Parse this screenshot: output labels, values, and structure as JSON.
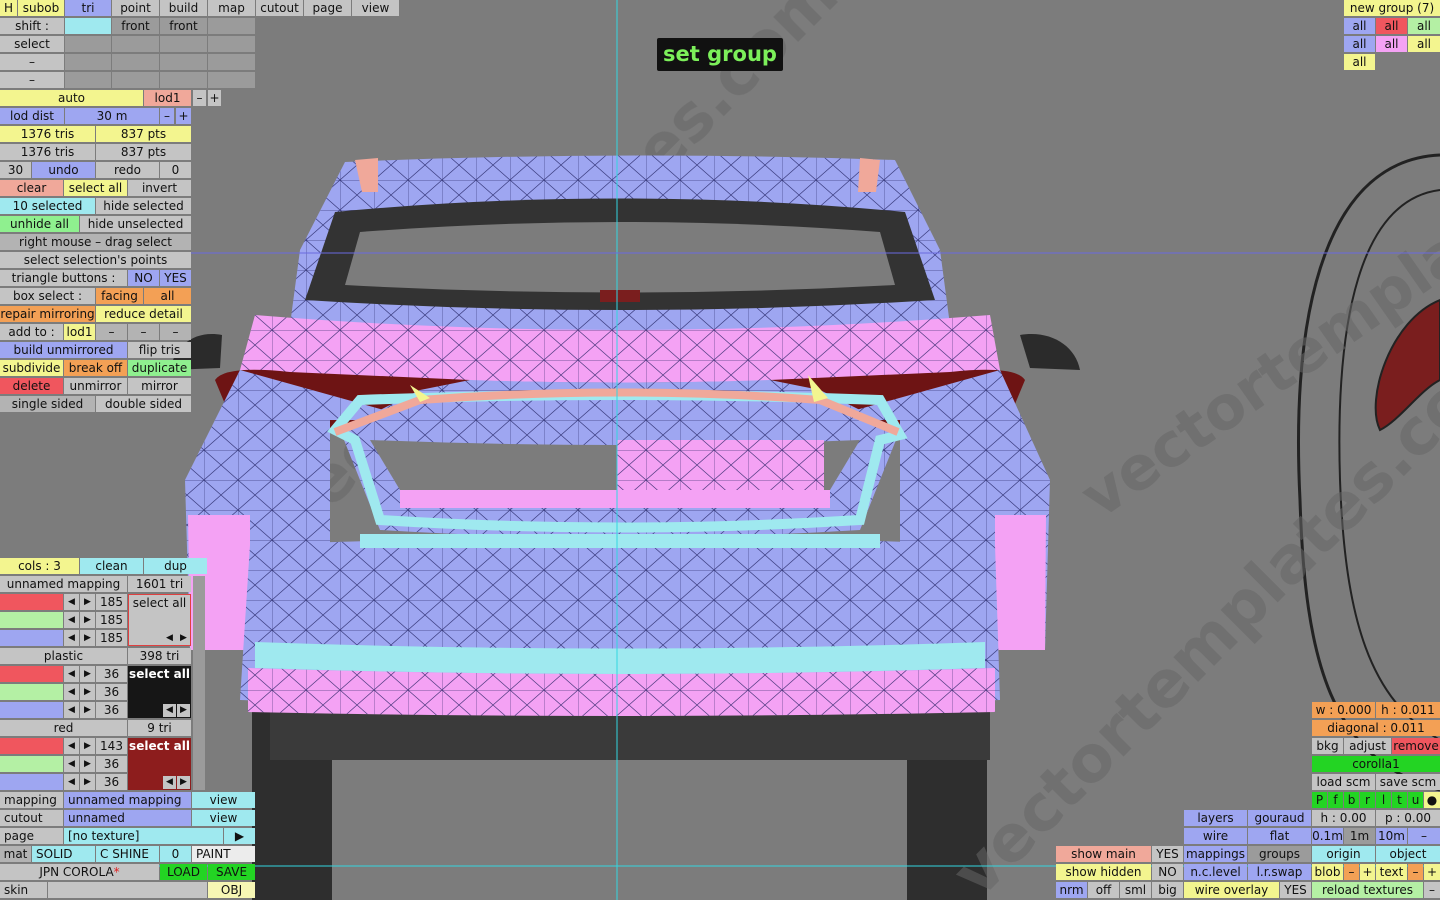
{
  "title_badge": "set group",
  "top_menu": {
    "h": "H",
    "subob": "subob",
    "tri": "tri",
    "point": "point",
    "build": "build",
    "map": "map",
    "cutout": "cutout",
    "page": "page",
    "view": "view",
    "shift": "shift :",
    "front1": "front",
    "front2": "front",
    "select": "select",
    "dash1": "–",
    "dash2": "–"
  },
  "lod": {
    "auto": "auto",
    "lod1": "lod1",
    "minus": "–",
    "plus": "+",
    "lod_dist": "lod dist",
    "dist_value": "30 m",
    "dist_minus": "–",
    "dist_plus": "+",
    "tris1": "1376 tris",
    "pts1": "837 pts",
    "tris2": "1376 tris",
    "pts2": "837 pts"
  },
  "edit": {
    "undo_count": "30",
    "undo": "undo",
    "redo": "redo",
    "redo_count": "0",
    "clear": "clear",
    "select_all": "select all",
    "invert": "invert",
    "selected_count": "10 selected",
    "hide_selected": "hide selected",
    "unhide_all": "unhide all",
    "hide_unselected": "hide unselected",
    "right_mouse": "right mouse – drag select",
    "select_points": "select selection's points",
    "triangle_buttons": "triangle buttons :",
    "no": "NO",
    "yes": "YES",
    "box_select": "box select :",
    "facing": "facing",
    "all": "all",
    "repair_mirroring": "repair mirroring",
    "reduce_detail": "reduce detail",
    "add_to": "add to :",
    "add_lod1": "lod1",
    "add_d1": "–",
    "add_d2": "–",
    "add_d3": "–",
    "build_unmirrored": "build unmirrored",
    "flip_tris": "flip tris",
    "subdivide": "subdivide",
    "break_off": "break off",
    "duplicate": "duplicate",
    "delete": "delete",
    "unmirror": "unmirror",
    "mirror": "mirror",
    "single_sided": "single sided",
    "double_sided": "double sided"
  },
  "materials": {
    "cols": "cols : 3",
    "clean": "clean",
    "dup": "dup",
    "groups": [
      {
        "name": "unnamed mapping",
        "tri": "1601 tri",
        "r": "185",
        "g": "185",
        "b": "185",
        "select_all": "select all"
      },
      {
        "name": "plastic",
        "tri": "398 tri",
        "r": "36",
        "g": "36",
        "b": "36",
        "select_all": "select all"
      },
      {
        "name": "red",
        "tri": "9 tri",
        "r": "143",
        "g": "36",
        "b": "36",
        "select_all": "select all"
      }
    ]
  },
  "bottom_left": {
    "mapping_label": "mapping",
    "mapping_value": "unnamed mapping",
    "view1": "view",
    "cutout_label": "cutout",
    "cutout_value": "unnamed",
    "view2": "view",
    "page_label": "page",
    "page_value": "[no texture]",
    "arrow": "▶",
    "mat": "mat",
    "solid": "SOLID",
    "cshine": "C SHINE",
    "zero": "0",
    "paint": "PAINT",
    "file_name": "JPN COROLA",
    "asterisk": "*",
    "load": "LOAD",
    "save": "SAVE",
    "skin": "skin",
    "obj": "OBJ"
  },
  "top_right": {
    "new_group": "new group (7)",
    "all": [
      "all",
      "all",
      "all",
      "all",
      "all",
      "all",
      "all"
    ]
  },
  "right_panel": {
    "w": "w : 0.000",
    "h": "h : 0.011",
    "diagonal": "diagonal : 0.011",
    "bkg": "bkg",
    "adjust": "adjust",
    "remove": "remove",
    "corolla": "corolla1",
    "load_scm": "load scm",
    "save_scm": "save scm",
    "letters": [
      "P",
      "f",
      "b",
      "r",
      "l",
      "t",
      "u",
      "●"
    ],
    "layers": "layers",
    "gouraud": "gouraud",
    "h0": "h : 0.00",
    "p0": "p : 0.00",
    "wire": "wire",
    "flat": "flat",
    "m01": "0.1m",
    "m1": "1m",
    "m10": "10m",
    "mdash": "–",
    "show_main": "show main",
    "yes1": "YES",
    "mappings": "mappings",
    "groups": "groups",
    "origin": "origin",
    "object": "object",
    "show_hidden": "show hidden",
    "no1": "NO",
    "nclevel": "n.c.level",
    "lrswap": "l.r.swap",
    "blob": "blob",
    "blob_minus": "–",
    "blob_plus": "+",
    "text": "text",
    "text_minus": "–",
    "text_plus": "+",
    "nrm": "nrm",
    "off": "off",
    "sml": "sml",
    "big": "big",
    "wire_overlay": "wire overlay",
    "yes2": "YES",
    "reload_textures": "reload textures",
    "end_dash": "–"
  },
  "colors": {
    "mesh_blue": "#9ea6f1",
    "mesh_pink": "#f4a2f4",
    "mesh_cyan": "#9fe9ef",
    "mesh_salmon": "#f0a89a",
    "guide_cyan": "#33d6e0",
    "badge_green": "#7cf05a"
  }
}
